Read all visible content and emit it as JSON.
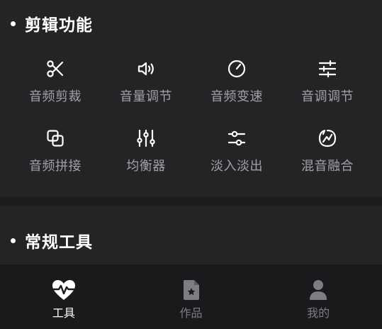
{
  "sections": {
    "edit": {
      "title": "剪辑功能",
      "tools": [
        {
          "label": "音频剪裁",
          "icon": "scissors-icon"
        },
        {
          "label": "音量调节",
          "icon": "speaker-icon"
        },
        {
          "label": "音频变速",
          "icon": "speed-gauge-icon"
        },
        {
          "label": "音调调节",
          "icon": "tune-sliders-icon"
        },
        {
          "label": "音频拼接",
          "icon": "merge-squares-icon"
        },
        {
          "label": "均衡器",
          "icon": "equalizer-icon"
        },
        {
          "label": "淡入淡出",
          "icon": "fade-sliders-icon"
        },
        {
          "label": "混音融合",
          "icon": "mix-blend-icon"
        }
      ]
    },
    "tools": {
      "title": "常规工具"
    }
  },
  "tabbar": {
    "tabs": [
      {
        "label": "工具",
        "icon": "heartbeat-icon",
        "active": true
      },
      {
        "label": "作品",
        "icon": "star-file-icon",
        "active": false
      },
      {
        "label": "我的",
        "icon": "user-icon",
        "active": false
      }
    ]
  },
  "colors": {
    "page_bg": "#1b1b1d",
    "card_bg": "#242426",
    "tabbar_bg": "#1a1a1c",
    "title_text": "#ffffff",
    "label_text": "#a2a2a6",
    "tab_inactive": "#7d7d82",
    "tab_active": "#ffffff"
  }
}
